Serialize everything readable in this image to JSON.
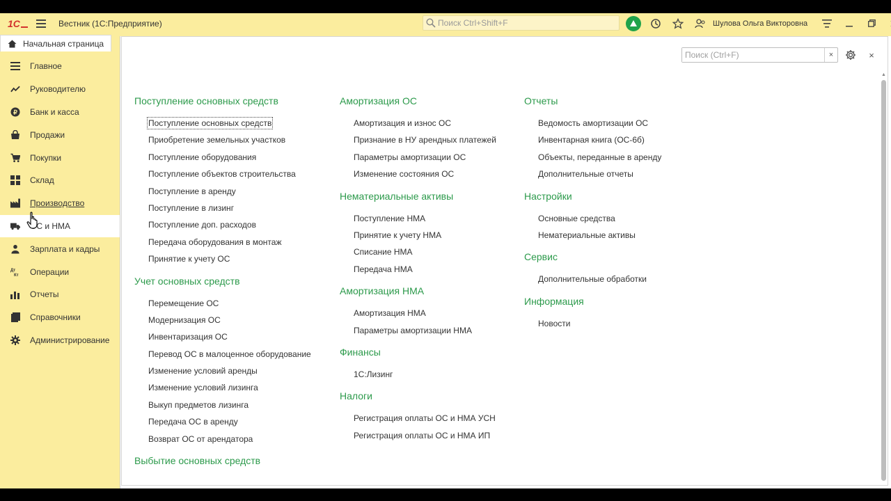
{
  "app": {
    "logo_text": "1С",
    "title": "Вестник  (1С:Предприятие)",
    "search_placeholder": "Поиск Ctrl+Shift+F",
    "user_name": "Шулова Ольга Викторовна",
    "accent_color": "#2c9a4b",
    "panel_color": "#fbed9e"
  },
  "home_tab": {
    "label": "Начальная страница",
    "icon": "home-icon"
  },
  "sidebar": {
    "items": [
      {
        "label": "Главное",
        "icon": "list-icon"
      },
      {
        "label": "Руководителю",
        "icon": "trend-icon"
      },
      {
        "label": "Банк и касса",
        "icon": "coin-icon"
      },
      {
        "label": "Продажи",
        "icon": "sales-icon"
      },
      {
        "label": "Покупки",
        "icon": "cart-icon"
      },
      {
        "label": "Склад",
        "icon": "warehouse-icon"
      },
      {
        "label": "Производство",
        "icon": "factory-icon"
      },
      {
        "label": "ОС и НМА",
        "icon": "truck-icon"
      },
      {
        "label": "Зарплата и кадры",
        "icon": "people-icon"
      },
      {
        "label": "Операции",
        "icon": "dt-kt-icon"
      },
      {
        "label": "Отчеты",
        "icon": "bar-chart-icon"
      },
      {
        "label": "Справочники",
        "icon": "book-icon"
      },
      {
        "label": "Администрирование",
        "icon": "gear-icon"
      }
    ]
  },
  "form": {
    "search_placeholder": "Поиск (Ctrl+F)",
    "clear_label": "×",
    "close_label": "×"
  },
  "columns": [
    {
      "groups": [
        {
          "title": "Поступление основных средств",
          "links": [
            "Поступление основных средств",
            "Приобретение земельных участков",
            "Поступление оборудования",
            "Поступление объектов строительства",
            "Поступление в аренду",
            "Поступление в лизинг",
            "Поступление доп. расходов",
            "Передача оборудования в монтаж",
            "Принятие к учету ОС"
          ]
        },
        {
          "title": "Учет основных средств",
          "links": [
            "Перемещение ОС",
            "Модернизация ОС",
            "Инвентаризация ОС",
            "Перевод ОС в малоценное оборудование",
            "Изменение условий аренды",
            "Изменение условий лизинга",
            "Выкуп предметов лизинга",
            "Передача ОС в аренду",
            "Возврат ОС от арендатора"
          ]
        },
        {
          "title": "Выбытие основных средств",
          "links": []
        }
      ]
    },
    {
      "groups": [
        {
          "title": "Амортизация ОС",
          "links": [
            "Амортизация и износ ОС",
            "Признание в НУ арендных платежей",
            "Параметры амортизации ОС",
            "Изменение состояния ОС"
          ]
        },
        {
          "title": "Нематериальные активы",
          "links": [
            "Поступление НМА",
            "Принятие к учету НМА",
            "Списание НМА",
            "Передача НМА"
          ]
        },
        {
          "title": "Амортизация НМА",
          "links": [
            "Амортизация НМА",
            "Параметры амортизации НМА"
          ]
        },
        {
          "title": "Финансы",
          "links": [
            "1С:Лизинг"
          ]
        },
        {
          "title": "Налоги",
          "links": [
            "Регистрация оплаты ОС и НМА УСН",
            "Регистрация оплаты ОС и НМА ИП"
          ]
        }
      ]
    },
    {
      "groups": [
        {
          "title": "Отчеты",
          "links": [
            "Ведомость амортизации ОС",
            "Инвентарная книга (ОС-6б)",
            "Объекты, переданные в аренду",
            "Дополнительные отчеты"
          ]
        },
        {
          "title": "Настройки",
          "links": [
            "Основные средства",
            "Нематериальные активы"
          ]
        },
        {
          "title": "Сервис",
          "links": [
            "Дополнительные обработки"
          ]
        },
        {
          "title": "Информация",
          "links": [
            "Новости"
          ]
        }
      ]
    }
  ]
}
